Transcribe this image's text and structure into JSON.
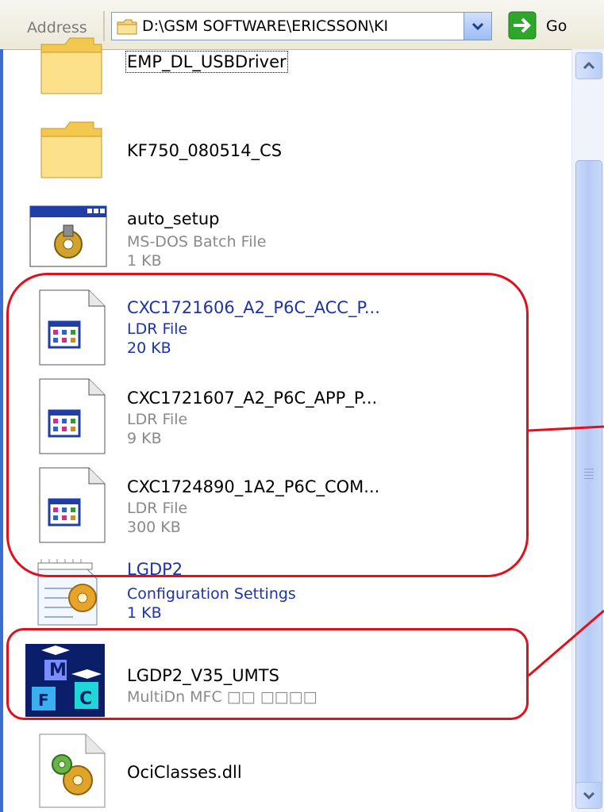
{
  "address_bar": {
    "label": "Address",
    "path": "D:\\GSM SOFTWARE\\ERICSSON\\KI",
    "go_label": "Go"
  },
  "files": [
    {
      "name": "EMP_DL_USBDriver",
      "type": "",
      "size": "",
      "icon": "folder-icon"
    },
    {
      "name": "KF750_080514_CS",
      "type": "",
      "size": "",
      "icon": "folder-icon"
    },
    {
      "name": "auto_setup",
      "type": "MS-DOS Batch File",
      "size": "1 KB",
      "icon": "batch-file-icon"
    },
    {
      "name": "CXC1721606_A2_P6C_ACC_P...",
      "type": "LDR File",
      "size": "20 KB",
      "icon": "ldr-file-icon"
    },
    {
      "name": "CXC1721607_A2_P6C_APP_P...",
      "type": "LDR File",
      "size": "9 KB",
      "icon": "ldr-file-icon"
    },
    {
      "name": "CXC1724890_1A2_P6C_COM...",
      "type": "LDR File",
      "size": "300 KB",
      "icon": "ldr-file-icon"
    },
    {
      "name": "LGDP2",
      "type": "Configuration Settings",
      "size": "1 KB",
      "icon": "config-settings-icon"
    },
    {
      "name": "LGDP2_V35_UMTS",
      "type": "MultiDn MFC □□ □□□□",
      "size": "",
      "icon": "mfc-app-icon"
    },
    {
      "name": "OciClasses.dll",
      "type": "",
      "size": "",
      "icon": "dll-file-icon"
    }
  ],
  "colors": {
    "annotation": "#e0111d",
    "link_blue": "#1d33a8",
    "frame_blue": "#3a6ed0"
  }
}
